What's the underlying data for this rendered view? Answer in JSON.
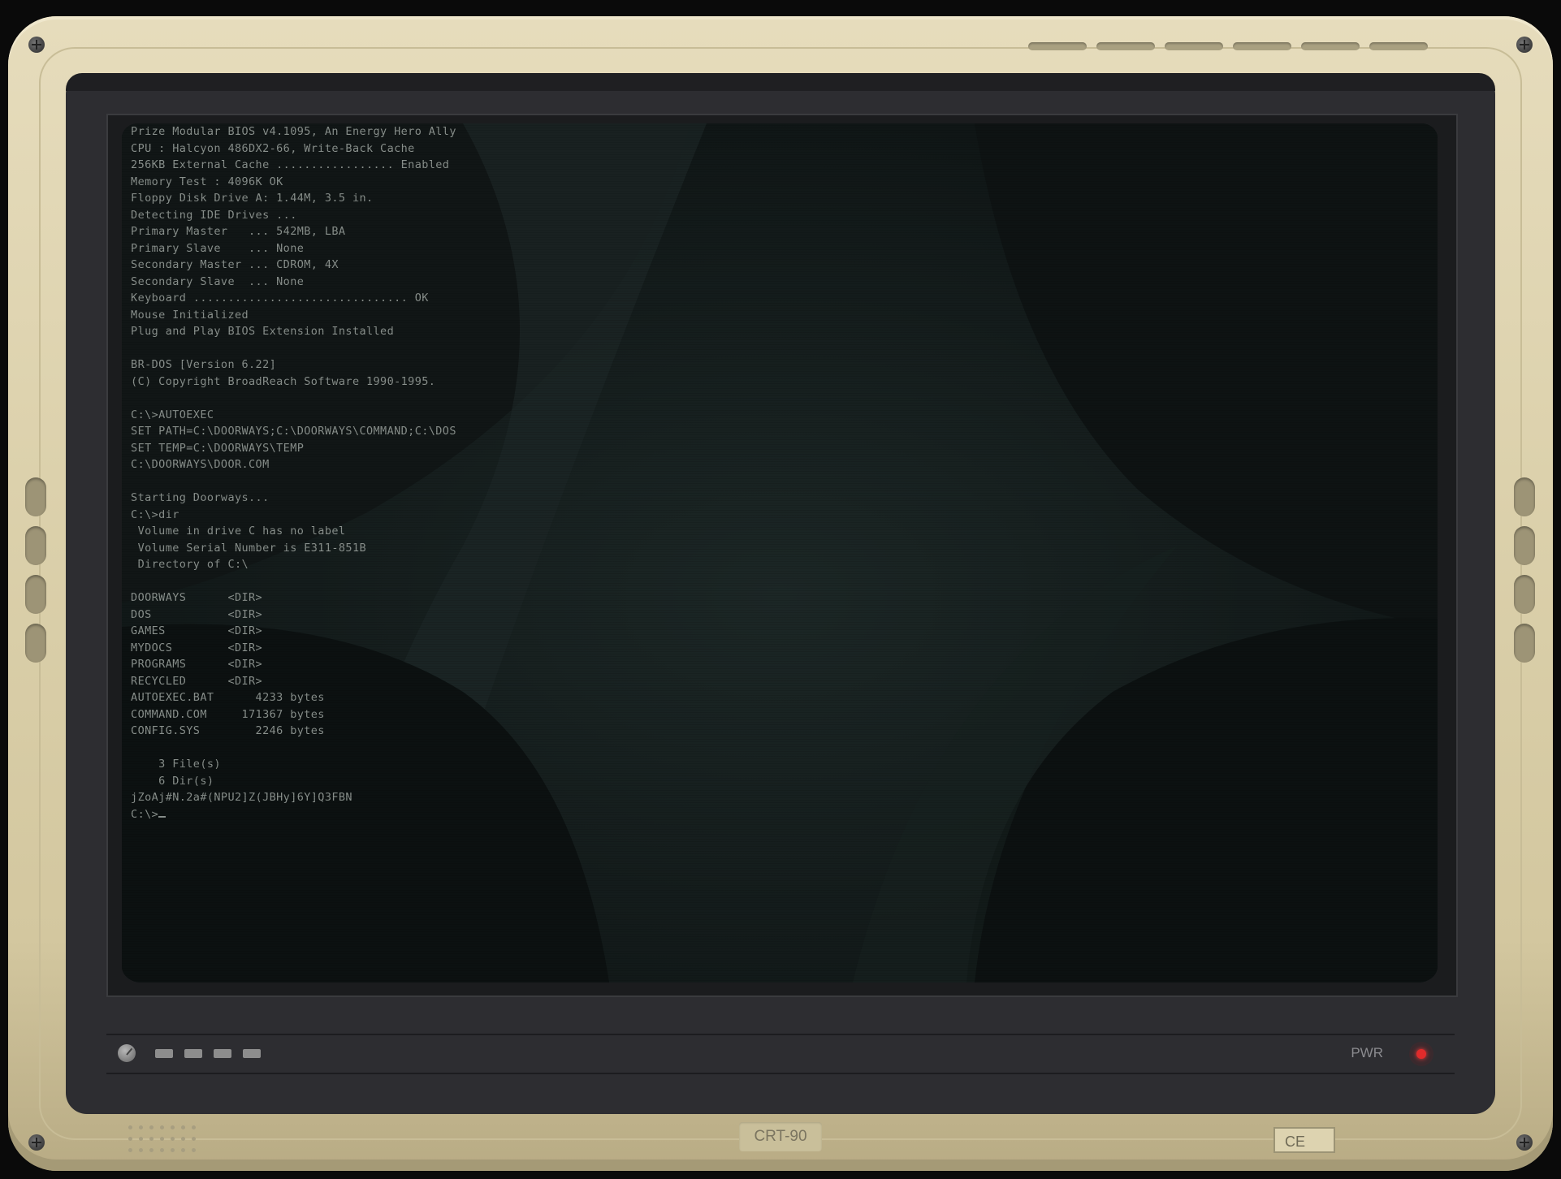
{
  "monitor": {
    "model_label": "CRT-90",
    "ce_label": "CE",
    "power_label": "PWR",
    "colors": {
      "bezel": "#e0d6b4",
      "housing": "#2d2d31",
      "screen": "#0d1212",
      "text": "#8a918d",
      "power_led": "#e02b2b"
    }
  },
  "terminal": {
    "lines": [
      "  Prize Modular BIOS v4.1095, An Energy Hero Ally",
      "  CPU : Halcyon 486DX2-66, Write-Back Cache",
      "  256KB External Cache ................. Enabled",
      "  Memory Test : 4096K OK",
      "  Floppy Disk Drive A: 1.44M, 3.5 in.",
      "  Detecting IDE Drives ...",
      "  Primary Master   ... 542MB, LBA",
      "  Primary Slave    ... None",
      "  Secondary Master ... CDROM, 4X",
      "  Secondary Slave  ... None",
      "  Keyboard ............................... OK",
      "  Mouse Initialized",
      "  Plug and Play BIOS Extension Installed",
      "",
      "  BR-DOS [Version 6.22]",
      "  (C) Copyright BroadReach Software 1990-1995.",
      "",
      "  C:\\>AUTOEXEC",
      "  SET PATH=C:\\DOORWAYS;C:\\DOORWAYS\\COMMAND;C:\\DOS",
      "  SET TEMP=C:\\DOORWAYS\\TEMP",
      "  C:\\DOORWAYS\\DOOR.COM",
      "",
      "  Starting Doorways...",
      "  C:\\>dir",
      "   Volume in drive C has no label",
      "   Volume Serial Number is E311-851B",
      "   Directory of C:\\",
      "",
      "  DOORWAYS      <DIR>",
      "  DOS           <DIR>",
      "  GAMES         <DIR>",
      "  MYDOCS        <DIR>",
      "  PROGRAMS      <DIR>",
      "  RECYCLED      <DIR>",
      "  AUTOEXEC.BAT      4233 bytes",
      "  COMMAND.COM     171367 bytes",
      "  CONFIG.SYS        2246 bytes",
      "",
      "      3 File(s)",
      "      6 Dir(s)",
      "  jZoAj#N.2a#(NPU2]Z(JBHy]6Y]Q3FBN"
    ],
    "prompt": "  C:\\>"
  }
}
